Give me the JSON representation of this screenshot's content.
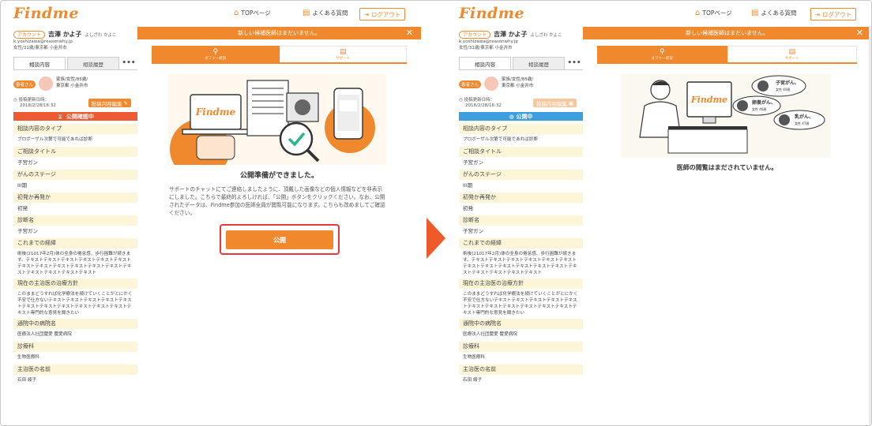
{
  "colors": {
    "accent": "#f0892e",
    "pending": "#ee5a34",
    "public": "#3f9ede",
    "highlight_box": "#e63a3a",
    "arrow": "#ef5a2a"
  },
  "header": {
    "logo": "Findme",
    "top_page": "TOPページ",
    "faq": "よくある質問",
    "logout": "ログアウト",
    "icons": [
      "home-icon",
      "chat-icon",
      "logout-icon"
    ]
  },
  "account": {
    "badge": "アカウント",
    "name": "吉澤 かよ子",
    "name_kana": "よしざわ かよこ",
    "email": "k.yoshizawa@reasonwhy.jp",
    "profile": "女性/31歳/東京都 小金井市"
  },
  "side_tabs": {
    "consult": "相談内容",
    "history": "相談履歴",
    "more": "•••"
  },
  "patient": {
    "tag": "患者さん",
    "info_line1": "家族/女性/85歳/",
    "info_line2": "東京都 小金井市"
  },
  "updated": {
    "label": "投稿更新日時：",
    "date": "2018/2/28/16:32"
  },
  "edit_button": "投稿内容編集",
  "status": {
    "pending": "公開確認中",
    "public": "公開中"
  },
  "fields": [
    {
      "h": "相談内容のタイプ",
      "v": "プロボーザル次第で可能であれば診断"
    },
    {
      "h": "ご相談タイトル",
      "v": "子宮ガン"
    },
    {
      "h": "がんのステージ",
      "v": "III期"
    },
    {
      "h": "初発か再発か",
      "v": "初発"
    },
    {
      "h": "診断名",
      "v": "子宮ガン"
    },
    {
      "h": "これまでの経緯",
      "v": "術後(21017年2月)体の全身の倦怠感、歩行困難が続きます。テキストテキストテキストテキストテキストテキストテキストテキストテキストテキストテキストテキストテキストテキストテキストテキストテキスト"
    },
    {
      "h": "現在の主治医の治療方針",
      "v": "このままどうすれば化学療法を続けていくことがとにかく不安で仕方ないテキストテキストテキストテキストテキストテキストテキストテキストテキストテキストテキストテキスト専門的な意見を聞きたい"
    },
    {
      "h": "通院中の病院名",
      "v": "医療法人社団慶愛 慶愛病院"
    },
    {
      "h": "診療科",
      "v": "生物医療科"
    },
    {
      "h": "主治医の名前",
      "v": "石田 綾子"
    }
  ],
  "banner": {
    "text": "新しい候補医師はまだいません。",
    "close": "✕"
  },
  "main_tabs": {
    "offer": "オファー状況",
    "support": "サポート"
  },
  "illustration1": {
    "screen_logo": "Findme"
  },
  "ready": {
    "title": "公開準備ができました。",
    "desc": "サポートのチャットにてご連絡しましたように、頂戴した画像などの個人情報などを非表示にしました。こちらで最終的よろしければ、「公開」ボタンをクリックください。なお、公開されたデータは、Findme参加の医師全員が閲覧可能になります。こちらも改めましてご確認ください。",
    "button": "公開"
  },
  "illustration2": {
    "screen_logo": "Findme",
    "bubbles": [
      {
        "title": "子宮がん、",
        "sub": "女性 40歳"
      },
      {
        "title": "卵巣がん、",
        "sub": "女性 46歳"
      },
      {
        "title": "乳がん、",
        "sub": "女性 47歳"
      }
    ]
  },
  "no_view": "医師の閲覧はまだされていません。"
}
